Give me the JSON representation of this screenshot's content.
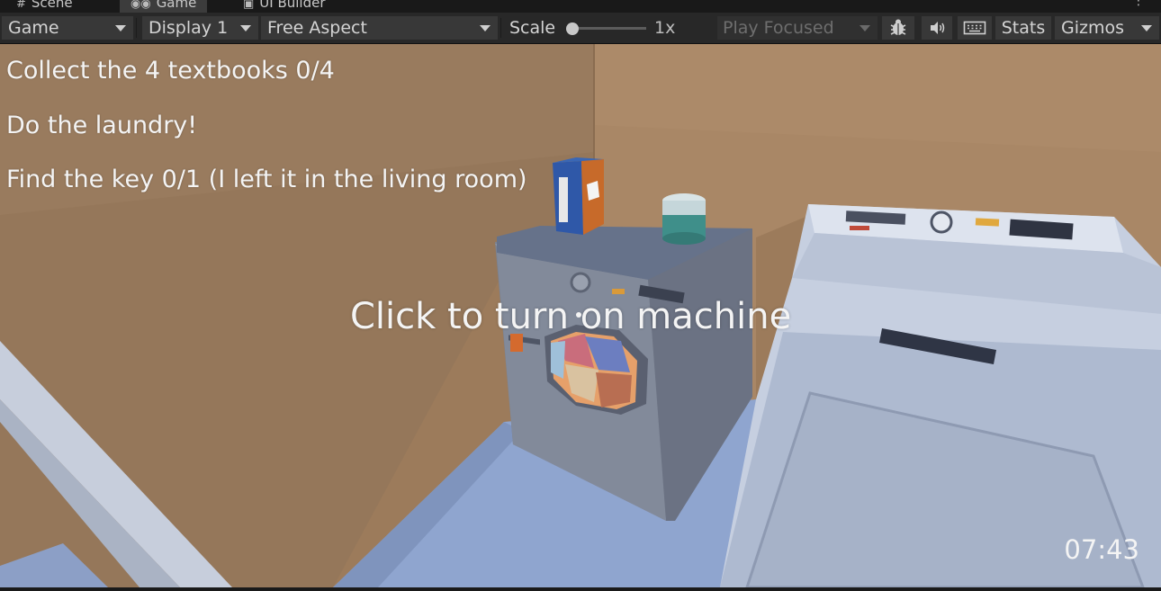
{
  "tabs": [
    {
      "label": "Scene",
      "icon": "hash-icon"
    },
    {
      "label": "Game",
      "icon": "gamepad-icon"
    },
    {
      "label": "UI Builder",
      "icon": "ui-builder-icon"
    }
  ],
  "toolbar": {
    "view_select": "Game",
    "display_select": "Display 1",
    "aspect_select": "Free Aspect",
    "scale_label": "Scale",
    "scale_value": "1x",
    "scale_level": 0.0,
    "play_mode_select": "Play Focused",
    "stats_label": "Stats",
    "gizmos_label": "Gizmos",
    "icons": [
      "bug-icon",
      "audio-mute-icon",
      "keyboard-icon"
    ]
  },
  "hud": {
    "objectives": [
      "Collect the 4 textbooks 0/4",
      "Do the laundry!",
      "Find the key 0/1 (I left it in the living room)"
    ],
    "interaction_prompt": "Click to turn on machine",
    "timer": "07:43"
  }
}
